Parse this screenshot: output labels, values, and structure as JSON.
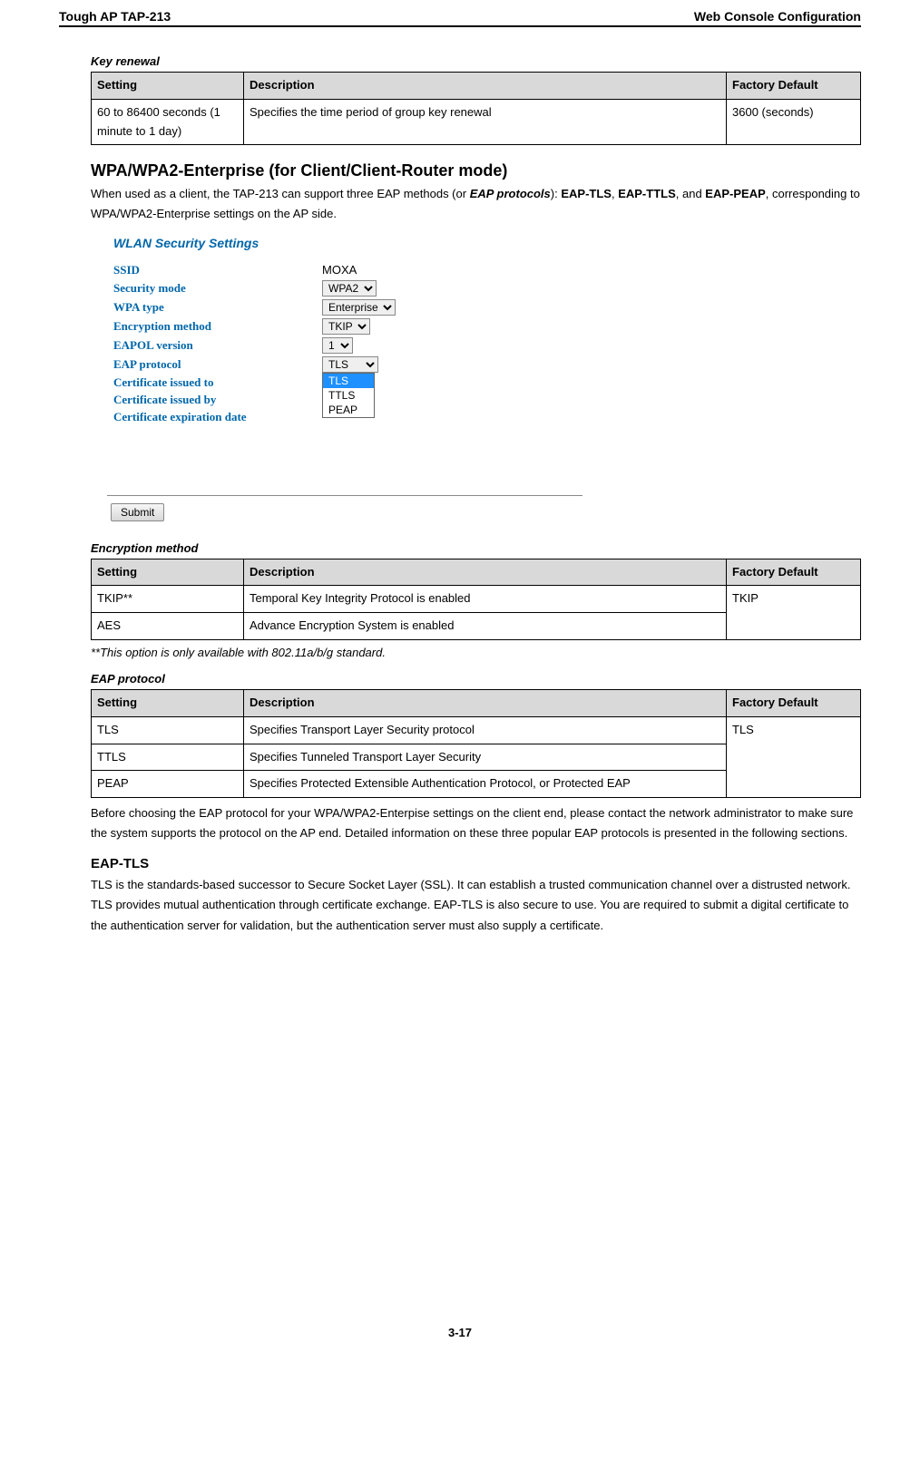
{
  "header": {
    "left": "Tough AP TAP-213",
    "right": "Web Console Configuration"
  },
  "key_renewal": {
    "label": "Key renewal",
    "headers": [
      "Setting",
      "Description",
      "Factory Default"
    ],
    "rows": [
      {
        "setting": "60 to 86400 seconds (1 minute to 1 day)",
        "desc": "Specifies the time period of group key renewal",
        "def": "3600 (seconds)"
      }
    ]
  },
  "wpa_section": {
    "title": "WPA/WPA2-Enterprise (for Client/Client-Router mode)",
    "intro_a": "When used as a client, the TAP-213 can support three EAP methods (or ",
    "intro_b": "EAP protocols",
    "intro_c": "): ",
    "intro_d": "EAP-TLS",
    "intro_e": ", ",
    "intro_f": "EAP-TTLS",
    "intro_g": ", and ",
    "intro_h": "EAP-PEAP",
    "intro_i": ", corresponding to WPA/WPA2-Enterprise settings on the AP side."
  },
  "console": {
    "title": "WLAN Security Settings",
    "fields": {
      "ssid": {
        "label": "SSID",
        "value": "MOXA"
      },
      "secmode": {
        "label": "Security mode",
        "value": "WPA2"
      },
      "wpatype": {
        "label": "WPA type",
        "value": "Enterprise"
      },
      "enc": {
        "label": "Encryption method",
        "value": "TKIP"
      },
      "eapolv": {
        "label": "EAPOL version",
        "value": "1"
      },
      "eapproto": {
        "label": "EAP protocol",
        "value": "TLS",
        "options": [
          "TLS",
          "TTLS",
          "PEAP"
        ]
      },
      "cert_to": {
        "label": "Certificate issued to"
      },
      "cert_by": {
        "label": "Certificate issued by"
      },
      "cert_exp": {
        "label": "Certificate expiration date"
      }
    },
    "submit": "Submit"
  },
  "enc_table": {
    "label": "Encryption method",
    "headers": [
      "Setting",
      "Description",
      "Factory Default"
    ],
    "rows": [
      {
        "setting": "TKIP**",
        "desc": "Temporal Key Integrity Protocol is enabled",
        "def": "TKIP"
      },
      {
        "setting": "AES",
        "desc": "Advance Encryption System is enabled"
      }
    ],
    "footnote": "**This option is only available with 802.11a/b/g standard."
  },
  "eap_table": {
    "label": "EAP protocol",
    "headers": [
      "Setting",
      "Description",
      "Factory Default"
    ],
    "rows": [
      {
        "setting": "TLS",
        "desc": "Specifies Transport Layer Security protocol",
        "def": "TLS"
      },
      {
        "setting": "TTLS",
        "desc": "Specifies Tunneled Transport Layer Security"
      },
      {
        "setting": "PEAP",
        "desc": "Specifies Protected Extensible Authentication Protocol, or Protected EAP"
      }
    ]
  },
  "after_eap_text": "Before choosing the EAP protocol for your WPA/WPA2-Enterpise settings on the client end, please contact the network administrator to make sure the system supports the protocol on the AP end. Detailed information on these three popular EAP protocols is presented in the following sections.",
  "eap_tls": {
    "title": "EAP-TLS",
    "text": "TLS is the standards-based successor to Secure Socket Layer (SSL). It can establish a trusted communication channel over a distrusted network. TLS provides mutual authentication through certificate exchange. EAP-TLS is also secure to use. You are required to submit a digital certificate to the authentication server for validation, but the authentication server must also supply a certificate."
  },
  "page_number": "3-17"
}
